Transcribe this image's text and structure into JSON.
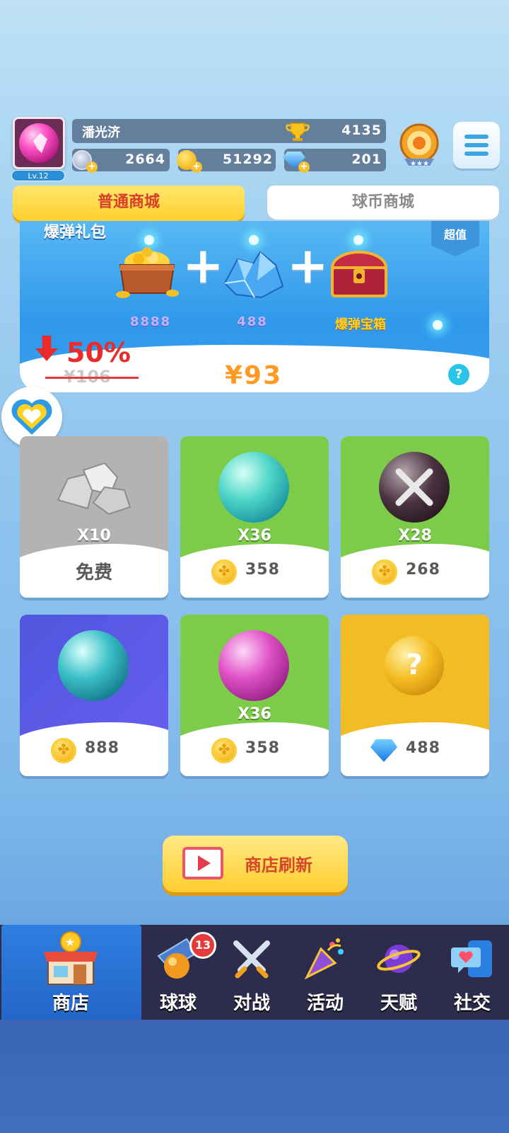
{
  "player": {
    "name": "潘光济",
    "level": "Lv.12",
    "trophies": "4135",
    "resources": {
      "energy": "2664",
      "coins": "51292",
      "diamonds": "201"
    }
  },
  "tabs": [
    {
      "label": "普通商城",
      "active": true
    },
    {
      "label": "球币商城",
      "active": false
    }
  ],
  "banner": {
    "title": "爆弹礼包",
    "ribbon": "超值",
    "items": [
      {
        "icon": "gold-chest-icon",
        "label": "8888"
      },
      {
        "icon": "crystal-pile-icon",
        "label": "488"
      },
      {
        "icon": "treasure-chest-icon",
        "label": "爆弹宝箱"
      }
    ],
    "discount": "50%",
    "old_price": "¥106",
    "new_price": "¥93"
  },
  "shop_items": [
    {
      "icon": "silver-ore-icon",
      "count": "X10",
      "price": "免费",
      "currency": "free",
      "theme": "#b5b5b5"
    },
    {
      "icon": "cyan-orb-icon",
      "count": "X36",
      "price": "358",
      "currency": "coin",
      "theme": "#7ccc49"
    },
    {
      "icon": "crossed-swords-orb-icon",
      "count": "X28",
      "price": "268",
      "currency": "coin",
      "theme": "#7ccc49"
    },
    {
      "icon": "swirl-orb-icon",
      "count": "",
      "price": "888",
      "currency": "coin",
      "theme": "#5a5fe0"
    },
    {
      "icon": "pink-orb-icon",
      "count": "X36",
      "price": "358",
      "currency": "coin",
      "theme": "#7ccc49"
    },
    {
      "icon": "mystery-orb-icon",
      "count": "",
      "price": "488",
      "currency": "diamond",
      "theme": "#f2bc25"
    }
  ],
  "refresh_button": {
    "label": "商店刷新"
  },
  "nav": [
    {
      "label": "商店",
      "icon": "shop-icon",
      "active": true
    },
    {
      "label": "球球",
      "icon": "ball-icon",
      "badge": "13"
    },
    {
      "label": "对战",
      "icon": "battle-swords-icon"
    },
    {
      "label": "活动",
      "icon": "party-popper-icon"
    },
    {
      "label": "天赋",
      "icon": "planet-icon"
    },
    {
      "label": "社交",
      "icon": "chat-heart-icon"
    }
  ]
}
